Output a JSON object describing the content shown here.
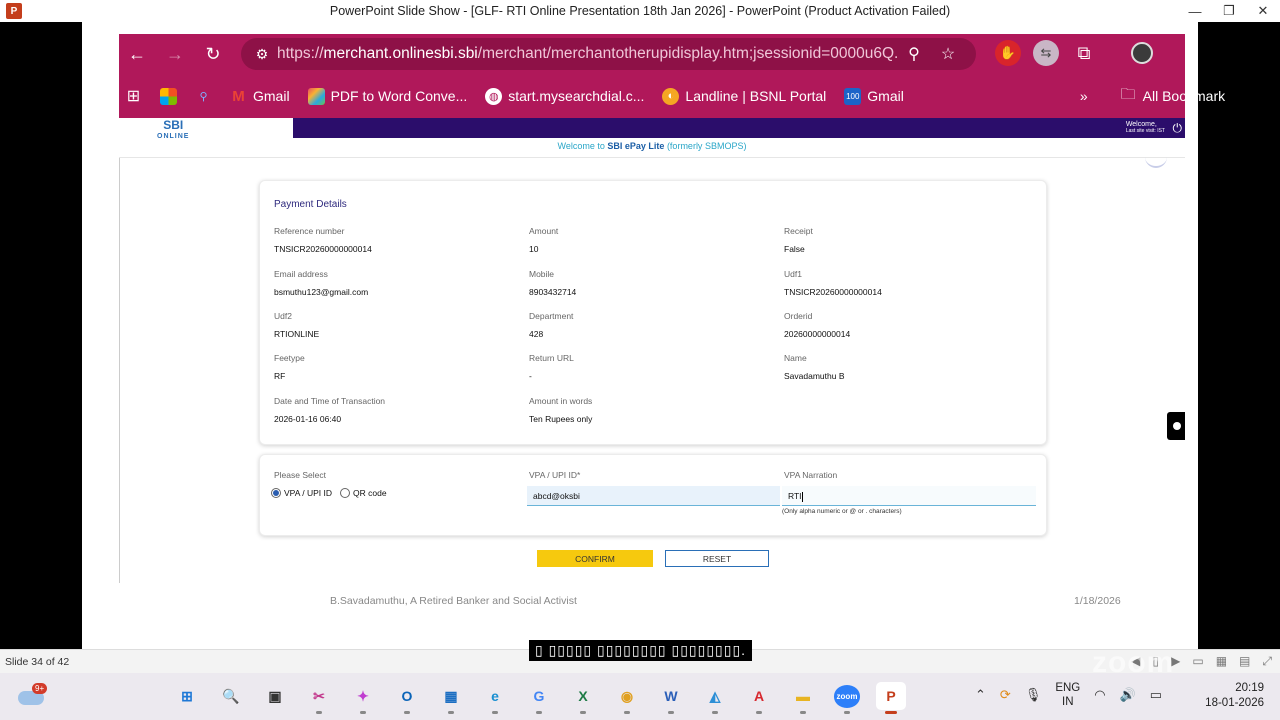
{
  "powerpoint": {
    "logo": "P",
    "title": "PowerPoint Slide Show - [GLF- RTI Online Presentation 18th Jan 2026] - PowerPoint (Product Activation Failed)",
    "slide_indicator": "Slide 34 of 42",
    "footer_left": "B.Savadamuthu, A Retired Banker and Social Activist",
    "footer_right": "1/18/2026",
    "caption": "▯ ▯▯▯▯▯ ▯▯▯▯▯▯▯▯ ▯▯▯▯▯▯▯▯."
  },
  "browser": {
    "url_prefix": "https://",
    "url_domain": "merchant.onlinesbi.sbi",
    "url_path": "/merchant/merchantotherupidisplay.htm;jsessionid=0000u6Q...",
    "bookmarks": [
      {
        "label": "Gmail",
        "icon": "gmail-icon"
      },
      {
        "label": "PDF to Word Conve...",
        "icon": "pdf-to-word-icon"
      },
      {
        "label": "start.mysearchdial.c...",
        "icon": "globe-icon"
      },
      {
        "label": "Landline | BSNL Portal",
        "icon": "bsnl-icon"
      },
      {
        "label": "Gmail",
        "icon": "hundred-icon"
      }
    ],
    "all_bookmarks": "All Bookmark",
    "more": "»"
  },
  "sbi": {
    "logo_text": "SBI",
    "logo_sub": "ONLINE",
    "welcome": "Welcome,",
    "last_visit": "Last site visit: IST",
    "welcome_strip_pre": "Welcome to ",
    "welcome_strip_brand": "SBI ePay Lite",
    "welcome_strip_post": " (formerly SBMOPS)"
  },
  "payment_details": {
    "title": "Payment Details",
    "fields": [
      {
        "label": "Reference number",
        "value": "TNSICR20260000000014"
      },
      {
        "label": "Amount",
        "value": "10"
      },
      {
        "label": "Receipt",
        "value": "False"
      },
      {
        "label": "Email address",
        "value": "bsmuthu123@gmail.com"
      },
      {
        "label": "Mobile",
        "value": "8903432714"
      },
      {
        "label": "Udf1",
        "value": "TNSICR20260000000014"
      },
      {
        "label": "Udf2",
        "value": "RTIONLINE"
      },
      {
        "label": "Department",
        "value": "428"
      },
      {
        "label": "Orderid",
        "value": "20260000000014"
      },
      {
        "label": "Feetype",
        "value": "RF"
      },
      {
        "label": "Return URL",
        "value": "-"
      },
      {
        "label": "Name",
        "value": "Savadamuthu B"
      },
      {
        "label": "Date and Time of Transaction",
        "value": "2026-01-16 06:40"
      },
      {
        "label": "Amount in words",
        "value": "Ten Rupees only"
      }
    ]
  },
  "upi": {
    "please_select": "Please Select",
    "option_vpa": "VPA / UPI ID",
    "option_qr": "QR code",
    "selected": "VPA / UPI ID",
    "vpa_label": "VPA / UPI ID*",
    "vpa_value": "abcd@oksbi",
    "narration_label": "VPA Narration",
    "narration_value": "RTI",
    "narration_hint": "(Only alpha numeric or @ or . characters)",
    "confirm": "CONFIRM",
    "reset": "RESET"
  },
  "taskbar": {
    "weather_badge": "9+",
    "apps": [
      {
        "name": "start-button",
        "glyph": "⊞",
        "color": "#1e78d6"
      },
      {
        "name": "search-icon",
        "glyph": "🔍",
        "color": "#1e5fb0"
      },
      {
        "name": "task-view-icon",
        "glyph": "▣",
        "color": "#333"
      },
      {
        "name": "snipping-tool-icon",
        "glyph": "✂",
        "color": "#c2388c"
      },
      {
        "name": "copilot-icon",
        "glyph": "✦",
        "color": "#c03dd0"
      },
      {
        "name": "outlook-icon",
        "glyph": "O",
        "color": "#0a64b8"
      },
      {
        "name": "store-icon",
        "glyph": "▦",
        "color": "#1b6ec2"
      },
      {
        "name": "edge-icon",
        "glyph": "e",
        "color": "#1a8fd1"
      },
      {
        "name": "google-icon",
        "glyph": "G",
        "color": "#4285f4"
      },
      {
        "name": "excel-icon",
        "glyph": "X",
        "color": "#1d7a45"
      },
      {
        "name": "chrome-icon",
        "glyph": "◉",
        "color": "#e0a021"
      },
      {
        "name": "word-icon",
        "glyph": "W",
        "color": "#2b5fb8"
      },
      {
        "name": "photos-icon",
        "glyph": "◭",
        "color": "#2d8fd6"
      },
      {
        "name": "acrobat-icon",
        "glyph": "A",
        "color": "#d7282f"
      },
      {
        "name": "file-explorer-icon",
        "glyph": "▬",
        "color": "#e8b422"
      },
      {
        "name": "zoom-icon",
        "glyph": "zoom",
        "color": "#2d7ff9"
      },
      {
        "name": "powerpoint-icon",
        "glyph": "P",
        "color": "#c43e1c"
      }
    ],
    "lang_top": "ENG",
    "lang_bottom": "IN",
    "time": "20:19",
    "date": "18-01-2026"
  },
  "watermark": "zoom"
}
